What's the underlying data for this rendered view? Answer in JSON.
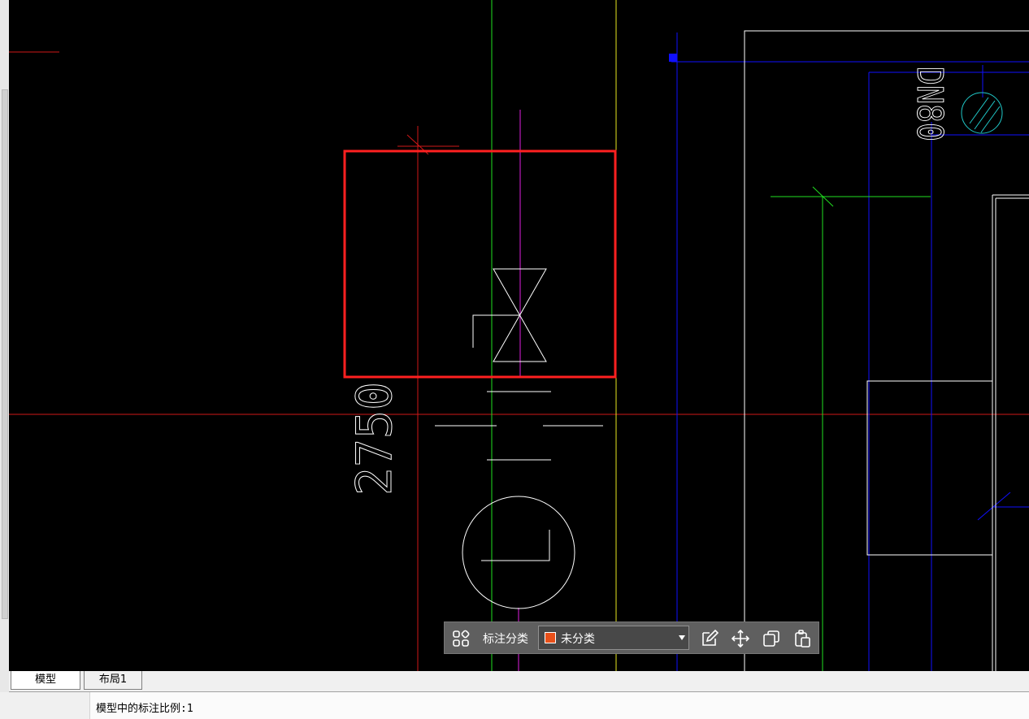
{
  "drawing": {
    "dim_text": "2750",
    "pipe_label": "DN80"
  },
  "colors": {
    "canvas_bg": "#000000",
    "red_line": "#d01818",
    "highlight_box": "#ff2020",
    "blue_line": "#1010ff",
    "green_line": "#20e020",
    "yellow_line": "#e8e820",
    "magenta_line": "#e020e0",
    "cyan_symbol": "#20c8c8",
    "category_swatch": "#e8501a"
  },
  "annotation_toolbar": {
    "grid_icon": "grid-icon",
    "label": "标注分类",
    "category_value": "未分类",
    "edit_icon": "edit-icon",
    "move_icon": "move-icon",
    "copy_icon": "copy-icon",
    "paste_icon": "paste-icon"
  },
  "tabs": [
    {
      "label": "模型",
      "active": true
    },
    {
      "label": "布局1",
      "active": false
    }
  ],
  "status_bar": {
    "text": "模型中的标注比例:1"
  }
}
